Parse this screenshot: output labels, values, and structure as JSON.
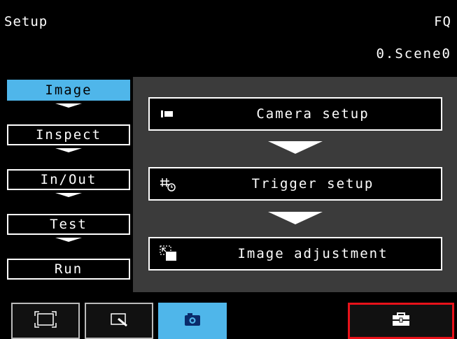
{
  "header": {
    "title": "Setup",
    "model": "FQ",
    "scene": "0.Scene0"
  },
  "sidebar": {
    "items": [
      {
        "label": "Image",
        "active": true
      },
      {
        "label": "Inspect",
        "active": false
      },
      {
        "label": "In/Out",
        "active": false
      },
      {
        "label": "Test",
        "active": false
      },
      {
        "label": "Run",
        "active": false
      }
    ]
  },
  "steps": [
    {
      "label": "Camera setup",
      "icon": "camera-setup-icon"
    },
    {
      "label": "Trigger setup",
      "icon": "trigger-icon"
    },
    {
      "label": "Image adjustment",
      "icon": "image-adjust-icon"
    }
  ],
  "toolbar": {
    "buttons": [
      {
        "icon": "fit-screen-icon",
        "active": false
      },
      {
        "icon": "zoom-icon",
        "active": false
      },
      {
        "icon": "camera-icon",
        "active": true
      },
      {
        "icon": "toolbox-icon",
        "active": false,
        "highlighted": true
      }
    ]
  },
  "colors": {
    "accent": "#4fb6ea",
    "panel": "#3b3b3b",
    "highlight": "#e8121a"
  }
}
